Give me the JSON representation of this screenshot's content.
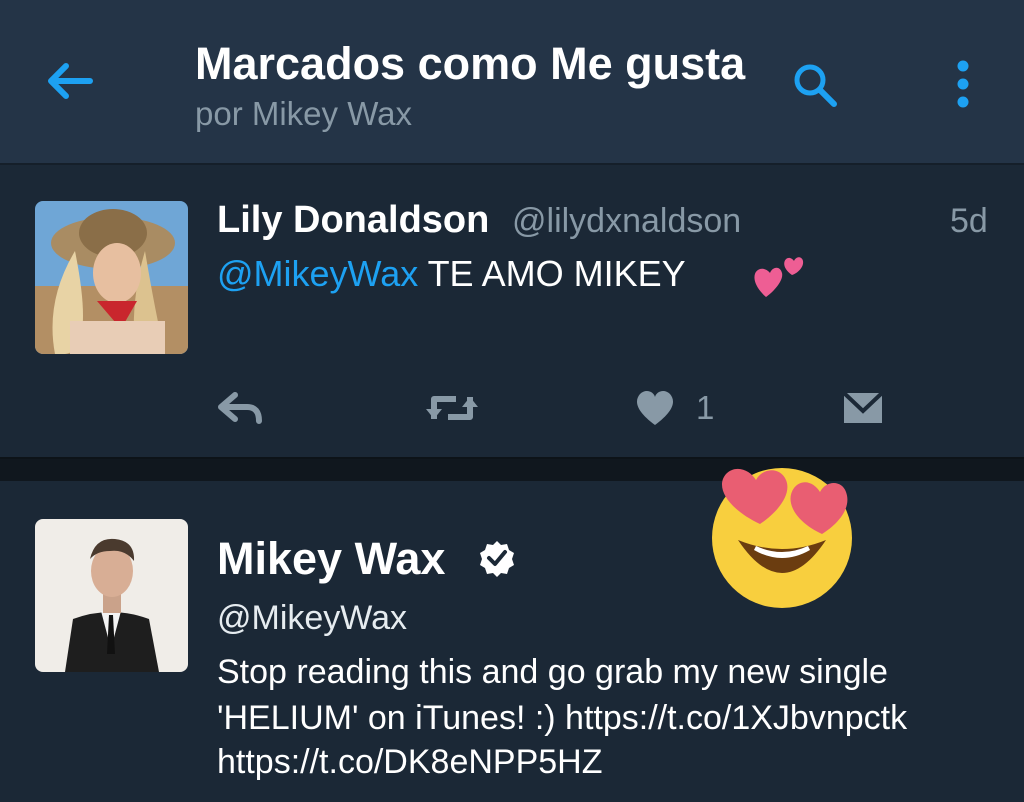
{
  "header": {
    "title": "Marcados como Me gusta",
    "subtitle": "por Mikey Wax"
  },
  "tweets": [
    {
      "name": "Lily Donaldson",
      "handle": "@lilydxnaldson",
      "time": "5d",
      "mention": "@MikeyWax",
      "text": " TE AMO MIKEY",
      "emoji": "two-hearts",
      "like_count": "1"
    },
    {
      "name": "Mikey Wax",
      "verified": true,
      "handle": "@MikeyWax",
      "text_lines": [
        "Stop reading this and go grab my new single",
        "'HELIUM' on iTunes! :) https://t.co/1XJbvnpctk",
        "https://t.co/DK8eNPP5HZ"
      ]
    }
  ],
  "colors": {
    "accent": "#1da1f2",
    "header_bg": "#243447",
    "feed_bg": "#1b2836",
    "muted": "#8899a6"
  }
}
